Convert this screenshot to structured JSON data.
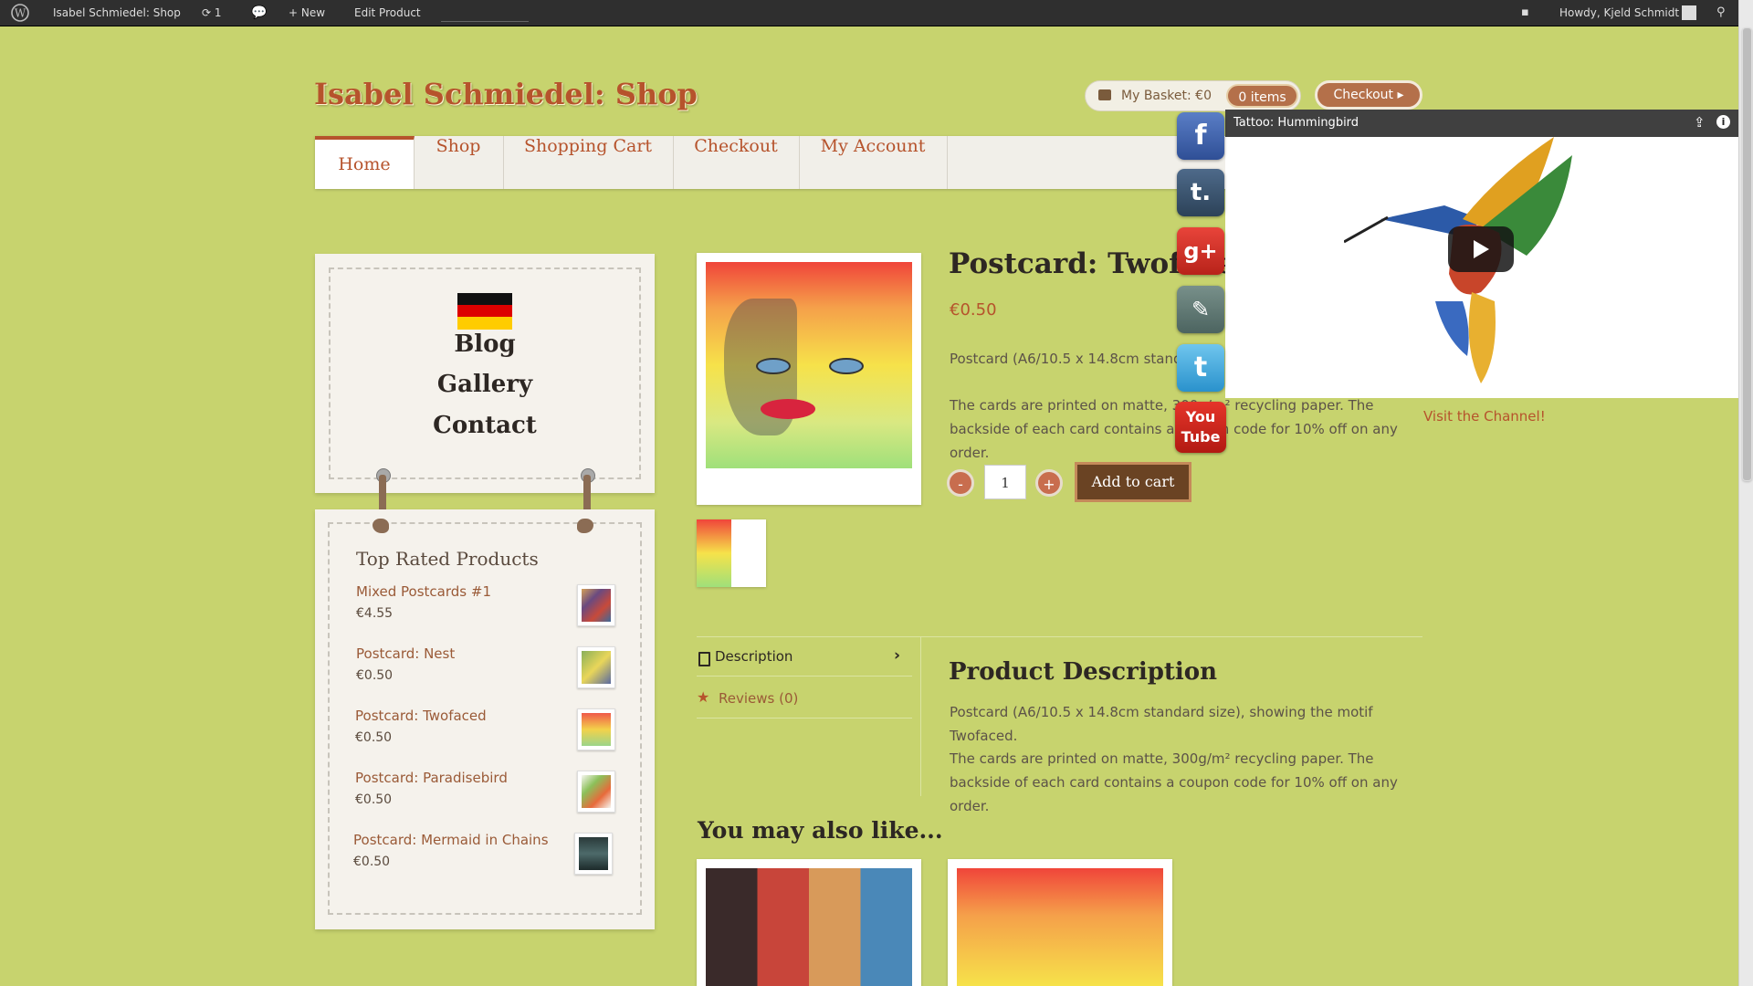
{
  "admin_bar": {
    "site_name": "Isabel Schmiedel: Shop",
    "updates_count": "1",
    "new_label": "New",
    "edit_label": "Edit Product",
    "greeting": "Howdy, Kjeld Schmidt"
  },
  "site": {
    "title": "Isabel Schmiedel: Shop"
  },
  "basket": {
    "label": "My Basket: €0",
    "items": "0 items",
    "checkout": "Checkout ▸"
  },
  "nav": {
    "items": [
      "Home",
      "Shop",
      "Shopping Cart",
      "Checkout",
      "My Account"
    ]
  },
  "sidebar": {
    "links": [
      "Blog",
      "Gallery",
      "Contact"
    ],
    "top_rated": {
      "title": "Top Rated Products",
      "products": [
        {
          "name": "Mixed Postcards #1",
          "price": "€4.55"
        },
        {
          "name": "Postcard: Nest",
          "price": "€0.50"
        },
        {
          "name": "Postcard: Twofaced",
          "price": "€0.50"
        },
        {
          "name": "Postcard: Paradisebird",
          "price": "€0.50"
        },
        {
          "name": "Postcard: Mermaid in Chains",
          "price": "€0.50"
        }
      ]
    }
  },
  "product": {
    "title": "Postcard: Twofaced",
    "price": "€0.50",
    "short_desc": "Postcard (A6/10.5 x 14.8cm standard",
    "long_desc": "The cards are printed on matte, 300g/m² recycling paper. The backside of each card contains a coupon code for 10% off on any order.",
    "quantity": "1",
    "add_to_cart": "Add to cart",
    "minus": "-",
    "plus": "+"
  },
  "tabs": {
    "description": "Description",
    "reviews": "Reviews (0)"
  },
  "description": {
    "heading": "Product Description",
    "line1": "Postcard (A6/10.5 x 14.8cm standard size), showing the motif Twofaced.",
    "line2": "The cards are printed on matte, 300g/m² recycling paper. The backside of each card contains a coupon code for 10% off on any order."
  },
  "related": {
    "heading": "You may also like..."
  },
  "video": {
    "title": "Tattoo: Hummingbird",
    "visit": "Visit the Channel!"
  },
  "social": {
    "items": [
      "facebook-icon",
      "tumblr-icon",
      "google-plus-icon",
      "deviantart-icon",
      "twitter-icon",
      "youtube-icon"
    ]
  }
}
